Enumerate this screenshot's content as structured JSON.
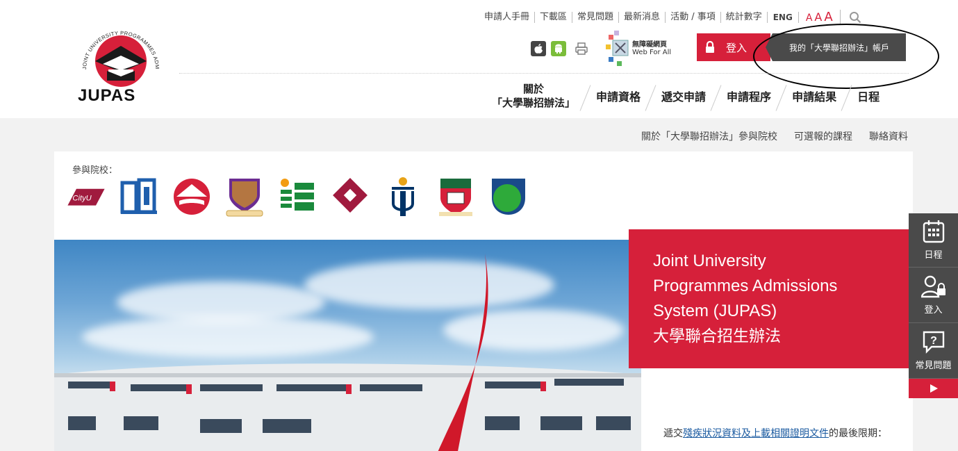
{
  "logo": {
    "text": "JUPAS",
    "ring_text": "JOINT UNIVERSITY PROGRAMMES ADMISSIONS SYSTEM"
  },
  "utility_links": [
    "申請人手冊",
    "下載區",
    "常見問題",
    "最新消息",
    "活動 / 事項",
    "統計數字"
  ],
  "language": "ENG",
  "font_sizes": [
    "A",
    "A",
    "A"
  ],
  "web_for_all": {
    "zh": "無障礙網頁",
    "en": "Web For All"
  },
  "login_label": "登入",
  "my_account_label": "我的「大學聯招辦法」帳戶",
  "main_nav": {
    "about_line1": "關於",
    "about_line2": "「大學聯招辦法」",
    "items": [
      "申請資格",
      "遞交申請",
      "申請程序",
      "申請結果",
      "日程"
    ]
  },
  "sub_nav": [
    "關於「大學聯招辦法」參與院校",
    "可選報的課程",
    "聯絡資料"
  ],
  "participating_label": "參與院校：",
  "institutions": [
    {
      "name": "CityU",
      "icon": "cityu-logo"
    },
    {
      "name": "EdUHK",
      "icon": "eduhk-logo"
    },
    {
      "name": "LingnanU",
      "icon": "lingnan-logo"
    },
    {
      "name": "CUHK",
      "icon": "cuhk-logo"
    },
    {
      "name": "HKBU",
      "icon": "hkbu-logo"
    },
    {
      "name": "PolyU",
      "icon": "polyu-logo"
    },
    {
      "name": "HKUST",
      "icon": "hkust-logo"
    },
    {
      "name": "HKU",
      "icon": "hku-logo"
    },
    {
      "name": "HKMU",
      "icon": "hkmu-logo"
    }
  ],
  "hero": {
    "title_en_1": "Joint University",
    "title_en_2": "Programmes Admissions",
    "title_en_3": "System (JUPAS)",
    "title_zh": "大學聯合招生辦法"
  },
  "notice": {
    "prefix": "遞交",
    "link": "殘疾狀況資料及上載相關證明文件",
    "suffix": "的最後限期："
  },
  "dock": [
    {
      "label": "日程",
      "icon": "calendar-icon"
    },
    {
      "label": "登入",
      "icon": "user-lock-icon"
    },
    {
      "label": "常見問題",
      "icon": "faq-icon"
    }
  ],
  "colors": {
    "brand_red": "#d6203a",
    "dark_grey": "#4a4a4a",
    "link_blue": "#1a5aa0"
  }
}
